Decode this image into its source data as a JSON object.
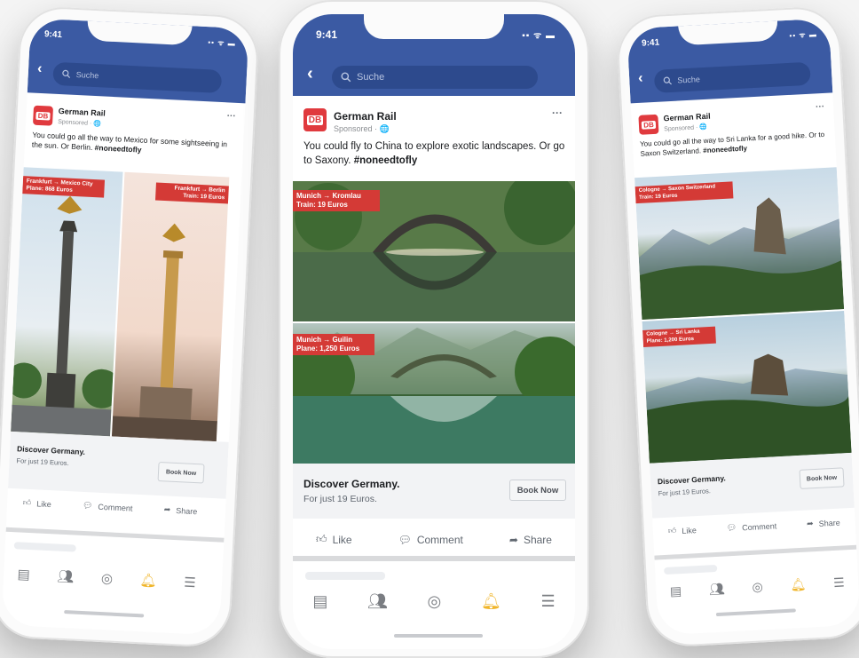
{
  "status": {
    "time": "9:41",
    "icons": "▪▪ ᯤ ▬"
  },
  "search": {
    "placeholder": "Suche"
  },
  "ad": {
    "page_name": "German Rail",
    "logo_text": "DB",
    "sponsored": "Sponsored · ",
    "globe": "🌐",
    "more": "···",
    "cta_title": "Discover Germany.",
    "cta_sub": "For just 19 Euros.",
    "book_label": "Book Now",
    "actions": {
      "like": "Like",
      "comment": "Comment",
      "share": "Share"
    }
  },
  "phones": [
    {
      "text_plain": "You could go all the way to Mexico for some sightseeing in the sun. Or Berlin. ",
      "hashtag": "#noneedtofly",
      "route1": {
        "line1": "Frankfurt → Mexico City",
        "line2": "Plane: 868 Euros"
      },
      "route2": {
        "line1": "Frankfurt → Berlin",
        "line2": "Train: 19 Euros"
      }
    },
    {
      "text_plain": "You could fly to China to explore exotic landscapes. Or go to Saxony. ",
      "hashtag": "#noneedtofly",
      "route1": {
        "line1": "Munich → Kromlau",
        "line2": "Train: 19 Euros"
      },
      "route2": {
        "line1": "Munich → Guilin",
        "line2": "Plane: 1,250 Euros"
      }
    },
    {
      "text_plain": "You could go all the way to Sri Lanka for a good hike. Or to Saxon Switzerland. ",
      "hashtag": "#noneedtofly",
      "route1": {
        "line1": "Cologne → Saxon Switzerland",
        "line2": "Train: 19 Euros"
      },
      "route2": {
        "line1": "Cologne → Sri Lanka",
        "line2": "Plane: 1,200 Euros"
      }
    }
  ],
  "colors": {
    "facebook_blue": "#3b5aa3",
    "db_red": "#e03a3e",
    "active_tab": "#f0b52a"
  }
}
